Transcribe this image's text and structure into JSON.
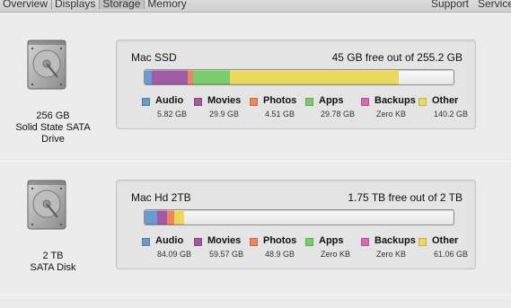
{
  "toolbar": {
    "tabs": [
      "Overview",
      "Displays",
      "Storage",
      "Memory"
    ],
    "right": [
      "Support",
      "Service"
    ]
  },
  "legend_colors": {
    "audio": "#6a9bd0",
    "movies": "#a05aa6",
    "photos": "#f0855e",
    "apps": "#78cd6a",
    "backups": "#d86ab6",
    "other": "#ebd95e"
  },
  "drives": [
    {
      "icon": "hard-drive-icon",
      "caption": [
        "256 GB",
        "Solid State SATA",
        "Drive"
      ],
      "volume_name": "Mac SSD",
      "free_text": "45 GB free out of 255.2 GB",
      "usage_percent": {
        "audio": 2.3,
        "movies": 11.7,
        "photos": 1.8,
        "apps": 11.7,
        "backups": 0,
        "other": 54.9
      },
      "legend": [
        {
          "key": "audio",
          "label": "Audio",
          "size": "5.82 GB"
        },
        {
          "key": "movies",
          "label": "Movies",
          "size": "29.9 GB"
        },
        {
          "key": "photos",
          "label": "Photos",
          "size": "4.51 GB"
        },
        {
          "key": "apps",
          "label": "Apps",
          "size": "29.78 GB"
        },
        {
          "key": "backups",
          "label": "Backups",
          "size": "Zero KB"
        },
        {
          "key": "other",
          "label": "Other",
          "size": "140.2 GB"
        }
      ]
    },
    {
      "icon": "hard-drive-icon",
      "caption": [
        "2 TB",
        "SATA Disk"
      ],
      "volume_name": "Mac Hd 2TB",
      "free_text": "1.75 TB free out of 2 TB",
      "usage_percent": {
        "audio": 4.2,
        "movies": 3.0,
        "photos": 2.4,
        "apps": 0,
        "backups": 0,
        "other": 3.1
      },
      "legend": [
        {
          "key": "audio",
          "label": "Audio",
          "size": "84.09 GB"
        },
        {
          "key": "movies",
          "label": "Movies",
          "size": "59.57 GB"
        },
        {
          "key": "photos",
          "label": "Photos",
          "size": "48.9 GB"
        },
        {
          "key": "apps",
          "label": "Apps",
          "size": "Zero KB"
        },
        {
          "key": "backups",
          "label": "Backups",
          "size": "Zero KB"
        },
        {
          "key": "other",
          "label": "Other",
          "size": "61.06 GB"
        }
      ]
    }
  ]
}
